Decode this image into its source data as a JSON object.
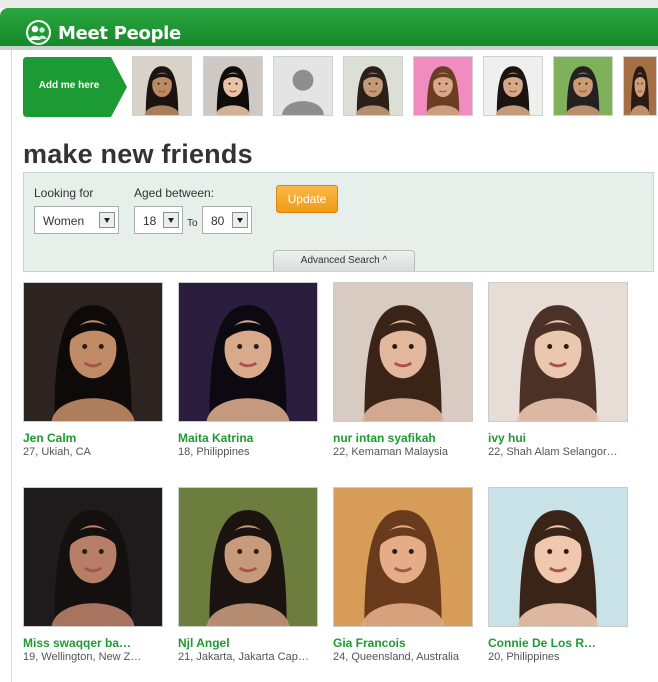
{
  "header": {
    "title": "Meet People"
  },
  "strip": {
    "add_me_label": "Add me here",
    "thumbnails": [
      {
        "bg": "#d9d2c8",
        "skin": "#b98a64",
        "hair": "#1c1410"
      },
      {
        "bg": "#cfc9c5",
        "skin": "#e8c3a6",
        "hair": "#0f0c0c"
      },
      {
        "bg": "#e4e4e4",
        "skin": "#8c8c8c",
        "hair": "#8c8c8c"
      },
      {
        "bg": "#dcdfd6",
        "skin": "#c49a78",
        "hair": "#2b2019"
      },
      {
        "bg": "#f08cc0",
        "skin": "#d8a78a",
        "hair": "#6b3d22"
      },
      {
        "bg": "#eef0ee",
        "skin": "#d6a886",
        "hair": "#1b1411"
      },
      {
        "bg": "#7fb05a",
        "skin": "#c99a73",
        "hair": "#222222"
      },
      {
        "bg": "#a56f45",
        "skin": "#cf9d78",
        "hair": "#2a1a12"
      }
    ]
  },
  "page": {
    "title": "make new friends"
  },
  "search": {
    "looking_for_label": "Looking for",
    "looking_for_value": "Women",
    "aged_between_label": "Aged between:",
    "age_min": "18",
    "to_label": "To",
    "age_max": "80",
    "update_label": "Update",
    "advanced_label": "Advanced Search ^"
  },
  "people": [
    {
      "name": "Jen Calm",
      "meta": "27, Ukiah, CA",
      "bg": "#2d2421",
      "skin": "#c08a66",
      "hair": "#0d0a09"
    },
    {
      "name": "Maita Katrina",
      "meta": "18, Philippines",
      "bg": "#2a1d3e",
      "skin": "#d9a98b",
      "hair": "#0c0a10"
    },
    {
      "name": "nur intan syafikah",
      "meta": "22, Kemaman Malaysia",
      "bg": "#d8cbc2",
      "skin": "#e3b79c",
      "hair": "#3a2418"
    },
    {
      "name": "ivy hui",
      "meta": "22, Shah Alam Selangor…",
      "bg": "#e7ddd6",
      "skin": "#ecc7b0",
      "hair": "#4b3126"
    },
    {
      "name": "Miss swaqqer ba…",
      "meta": "19, Wellington, New Z…",
      "bg": "#1f1a1b",
      "skin": "#b77f68",
      "hair": "#141010"
    },
    {
      "name": "Njl Angel",
      "meta": "21, Jakarta, Jakarta Cap…",
      "bg": "#6c7d3e",
      "skin": "#c69a7a",
      "hair": "#1a1310"
    },
    {
      "name": "Gia Francois",
      "meta": "24, Queensland, Australia",
      "bg": "#d69c58",
      "skin": "#e4ad88",
      "hair": "#6a3a1c"
    },
    {
      "name": "Connie De Los R…",
      "meta": "20, Philippines",
      "bg": "#c9e2e8",
      "skin": "#f0c8ae",
      "hair": "#3a2418"
    }
  ]
}
